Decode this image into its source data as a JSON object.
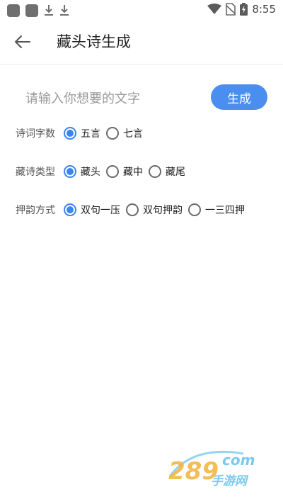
{
  "status_bar": {
    "time": "8:55",
    "icons": [
      "app-square-icon",
      "app-square-icon",
      "download-icon",
      "download-icon",
      "wifi-icon",
      "no-sim-icon",
      "battery-charging-icon"
    ]
  },
  "toolbar": {
    "back_icon": "arrow-left-icon",
    "title": "藏头诗生成"
  },
  "input": {
    "placeholder": "请输入你想要的文字",
    "value": ""
  },
  "generate_button": {
    "label": "生成",
    "color": "#4a8ef0"
  },
  "groups": [
    {
      "label": "诗词字数",
      "options": [
        {
          "label": "五言",
          "checked": true
        },
        {
          "label": "七言",
          "checked": false
        }
      ]
    },
    {
      "label": "藏诗类型",
      "options": [
        {
          "label": "藏头",
          "checked": true
        },
        {
          "label": "藏中",
          "checked": false
        },
        {
          "label": "藏尾",
          "checked": false
        }
      ]
    },
    {
      "label": "押韵方式",
      "options": [
        {
          "label": "双句一压",
          "checked": true
        },
        {
          "label": "双句押韵",
          "checked": false
        },
        {
          "label": "一三四押",
          "checked": false
        }
      ]
    }
  ],
  "colors": {
    "accent": "#3d84ee"
  },
  "watermark": {
    "brand": "289",
    "suffix": "com",
    "sub": "手游网"
  }
}
